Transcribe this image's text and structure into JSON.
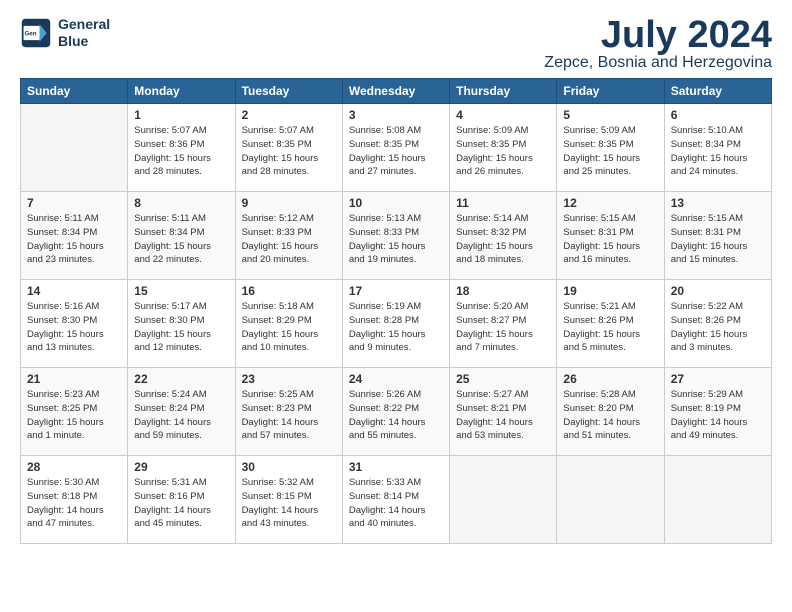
{
  "logo": {
    "line1": "General",
    "line2": "Blue"
  },
  "title": "July 2024",
  "location": "Zepce, Bosnia and Herzegovina",
  "days_of_week": [
    "Sunday",
    "Monday",
    "Tuesday",
    "Wednesday",
    "Thursday",
    "Friday",
    "Saturday"
  ],
  "weeks": [
    [
      {
        "day": "",
        "info": ""
      },
      {
        "day": "1",
        "info": "Sunrise: 5:07 AM\nSunset: 8:36 PM\nDaylight: 15 hours\nand 28 minutes."
      },
      {
        "day": "2",
        "info": "Sunrise: 5:07 AM\nSunset: 8:35 PM\nDaylight: 15 hours\nand 28 minutes."
      },
      {
        "day": "3",
        "info": "Sunrise: 5:08 AM\nSunset: 8:35 PM\nDaylight: 15 hours\nand 27 minutes."
      },
      {
        "day": "4",
        "info": "Sunrise: 5:09 AM\nSunset: 8:35 PM\nDaylight: 15 hours\nand 26 minutes."
      },
      {
        "day": "5",
        "info": "Sunrise: 5:09 AM\nSunset: 8:35 PM\nDaylight: 15 hours\nand 25 minutes."
      },
      {
        "day": "6",
        "info": "Sunrise: 5:10 AM\nSunset: 8:34 PM\nDaylight: 15 hours\nand 24 minutes."
      }
    ],
    [
      {
        "day": "7",
        "info": "Sunrise: 5:11 AM\nSunset: 8:34 PM\nDaylight: 15 hours\nand 23 minutes."
      },
      {
        "day": "8",
        "info": "Sunrise: 5:11 AM\nSunset: 8:34 PM\nDaylight: 15 hours\nand 22 minutes."
      },
      {
        "day": "9",
        "info": "Sunrise: 5:12 AM\nSunset: 8:33 PM\nDaylight: 15 hours\nand 20 minutes."
      },
      {
        "day": "10",
        "info": "Sunrise: 5:13 AM\nSunset: 8:33 PM\nDaylight: 15 hours\nand 19 minutes."
      },
      {
        "day": "11",
        "info": "Sunrise: 5:14 AM\nSunset: 8:32 PM\nDaylight: 15 hours\nand 18 minutes."
      },
      {
        "day": "12",
        "info": "Sunrise: 5:15 AM\nSunset: 8:31 PM\nDaylight: 15 hours\nand 16 minutes."
      },
      {
        "day": "13",
        "info": "Sunrise: 5:15 AM\nSunset: 8:31 PM\nDaylight: 15 hours\nand 15 minutes."
      }
    ],
    [
      {
        "day": "14",
        "info": "Sunrise: 5:16 AM\nSunset: 8:30 PM\nDaylight: 15 hours\nand 13 minutes."
      },
      {
        "day": "15",
        "info": "Sunrise: 5:17 AM\nSunset: 8:30 PM\nDaylight: 15 hours\nand 12 minutes."
      },
      {
        "day": "16",
        "info": "Sunrise: 5:18 AM\nSunset: 8:29 PM\nDaylight: 15 hours\nand 10 minutes."
      },
      {
        "day": "17",
        "info": "Sunrise: 5:19 AM\nSunset: 8:28 PM\nDaylight: 15 hours\nand 9 minutes."
      },
      {
        "day": "18",
        "info": "Sunrise: 5:20 AM\nSunset: 8:27 PM\nDaylight: 15 hours\nand 7 minutes."
      },
      {
        "day": "19",
        "info": "Sunrise: 5:21 AM\nSunset: 8:26 PM\nDaylight: 15 hours\nand 5 minutes."
      },
      {
        "day": "20",
        "info": "Sunrise: 5:22 AM\nSunset: 8:26 PM\nDaylight: 15 hours\nand 3 minutes."
      }
    ],
    [
      {
        "day": "21",
        "info": "Sunrise: 5:23 AM\nSunset: 8:25 PM\nDaylight: 15 hours\nand 1 minute."
      },
      {
        "day": "22",
        "info": "Sunrise: 5:24 AM\nSunset: 8:24 PM\nDaylight: 14 hours\nand 59 minutes."
      },
      {
        "day": "23",
        "info": "Sunrise: 5:25 AM\nSunset: 8:23 PM\nDaylight: 14 hours\nand 57 minutes."
      },
      {
        "day": "24",
        "info": "Sunrise: 5:26 AM\nSunset: 8:22 PM\nDaylight: 14 hours\nand 55 minutes."
      },
      {
        "day": "25",
        "info": "Sunrise: 5:27 AM\nSunset: 8:21 PM\nDaylight: 14 hours\nand 53 minutes."
      },
      {
        "day": "26",
        "info": "Sunrise: 5:28 AM\nSunset: 8:20 PM\nDaylight: 14 hours\nand 51 minutes."
      },
      {
        "day": "27",
        "info": "Sunrise: 5:29 AM\nSunset: 8:19 PM\nDaylight: 14 hours\nand 49 minutes."
      }
    ],
    [
      {
        "day": "28",
        "info": "Sunrise: 5:30 AM\nSunset: 8:18 PM\nDaylight: 14 hours\nand 47 minutes."
      },
      {
        "day": "29",
        "info": "Sunrise: 5:31 AM\nSunset: 8:16 PM\nDaylight: 14 hours\nand 45 minutes."
      },
      {
        "day": "30",
        "info": "Sunrise: 5:32 AM\nSunset: 8:15 PM\nDaylight: 14 hours\nand 43 minutes."
      },
      {
        "day": "31",
        "info": "Sunrise: 5:33 AM\nSunset: 8:14 PM\nDaylight: 14 hours\nand 40 minutes."
      },
      {
        "day": "",
        "info": ""
      },
      {
        "day": "",
        "info": ""
      },
      {
        "day": "",
        "info": ""
      }
    ]
  ]
}
